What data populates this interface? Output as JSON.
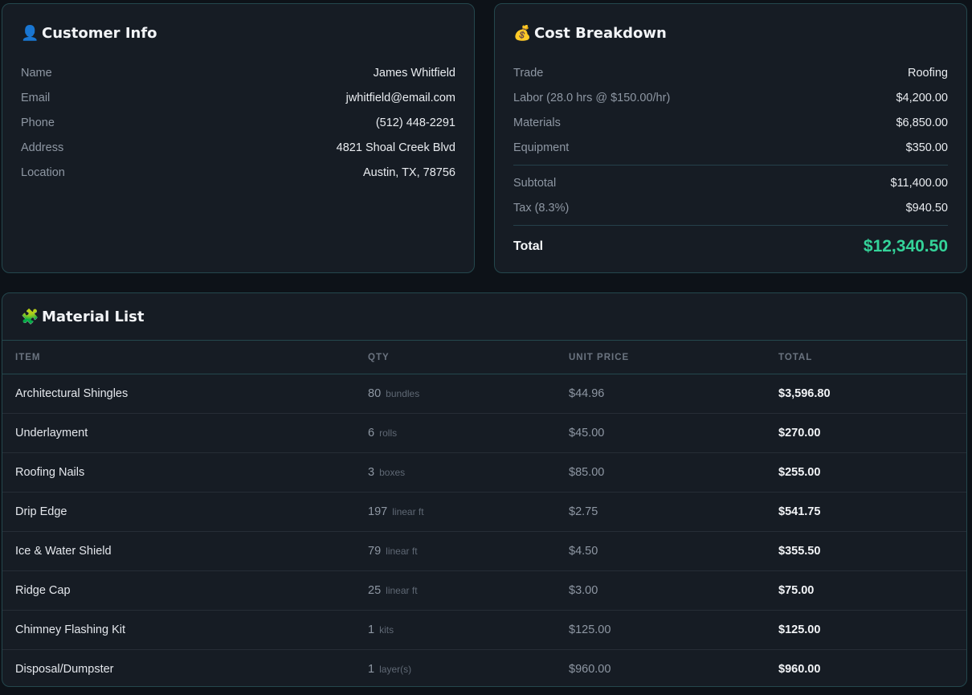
{
  "customer": {
    "icon": "person-icon",
    "title": "Customer Info",
    "rows": [
      {
        "label": "Name",
        "value": "James Whitfield"
      },
      {
        "label": "Email",
        "value": "jwhitfield@email.com"
      },
      {
        "label": "Phone",
        "value": "(512) 448-2291"
      },
      {
        "label": "Address",
        "value": "4821 Shoal Creek Blvd"
      },
      {
        "label": "Location",
        "value": "Austin, TX, 78756"
      }
    ]
  },
  "cost": {
    "icon": "money-bag-icon",
    "title": "Cost Breakdown",
    "rows": [
      {
        "label": "Trade",
        "value": "Roofing"
      },
      {
        "label": "Labor (28.0 hrs @ $150.00/hr)",
        "value": "$4,200.00"
      },
      {
        "label": "Materials",
        "value": "$6,850.00"
      },
      {
        "label": "Equipment",
        "value": "$350.00"
      }
    ],
    "subtotal_label": "Subtotal",
    "subtotal_value": "$11,400.00",
    "tax_label": "Tax (8.3%)",
    "tax_value": "$940.50",
    "total_label": "Total",
    "total_value": "$12,340.50",
    "total_color": "#34d399"
  },
  "materials": {
    "icon": "puzzle-piece-icon",
    "title": "Material List",
    "headers": {
      "item": "ITEM",
      "qty": "QTY",
      "unit_price": "UNIT PRICE",
      "total": "TOTAL"
    },
    "rows": [
      {
        "item": "Architectural Shingles",
        "qty": "80",
        "unit": "bundles",
        "unit_price": "$44.96",
        "total": "$3,596.80"
      },
      {
        "item": "Underlayment",
        "qty": "6",
        "unit": "rolls",
        "unit_price": "$45.00",
        "total": "$270.00"
      },
      {
        "item": "Roofing Nails",
        "qty": "3",
        "unit": "boxes",
        "unit_price": "$85.00",
        "total": "$255.00"
      },
      {
        "item": "Drip Edge",
        "qty": "197",
        "unit": "linear ft",
        "unit_price": "$2.75",
        "total": "$541.75"
      },
      {
        "item": "Ice & Water Shield",
        "qty": "79",
        "unit": "linear ft",
        "unit_price": "$4.50",
        "total": "$355.50"
      },
      {
        "item": "Ridge Cap",
        "qty": "25",
        "unit": "linear ft",
        "unit_price": "$3.00",
        "total": "$75.00"
      },
      {
        "item": "Chimney Flashing Kit",
        "qty": "1",
        "unit": "kits",
        "unit_price": "$125.00",
        "total": "$125.00"
      },
      {
        "item": "Disposal/Dumpster",
        "qty": "1",
        "unit": "layer(s)",
        "unit_price": "$960.00",
        "total": "$960.00"
      }
    ]
  }
}
